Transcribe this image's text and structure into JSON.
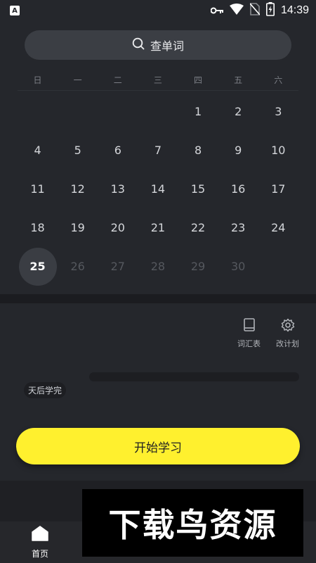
{
  "status_bar": {
    "app_badge": "A",
    "time": "14:39",
    "icons": [
      "key-icon",
      "wifi-icon",
      "no-sim-icon",
      "battery-charging-icon"
    ]
  },
  "search": {
    "label": "查单词",
    "icon": "search-icon"
  },
  "calendar": {
    "weekdays": [
      "日",
      "一",
      "二",
      "三",
      "四",
      "五",
      "六"
    ],
    "days": [
      "1",
      "2",
      "3",
      "4",
      "5",
      "6",
      "7",
      "8",
      "9",
      "10",
      "11",
      "12",
      "13",
      "14",
      "15",
      "16",
      "17",
      "18",
      "19",
      "20",
      "21",
      "22",
      "23",
      "24",
      "25",
      "26",
      "27",
      "28",
      "29",
      "30"
    ],
    "leading_blanks": 4,
    "today": "25"
  },
  "tools": {
    "vocab_label": "词汇表",
    "vocab_icon": "book-icon",
    "plan_label": "改计划",
    "plan_icon": "gear-icon"
  },
  "plan": {
    "days_left_label": "天后学完",
    "progress": 0
  },
  "actions": {
    "start_label": "开始学习"
  },
  "tabbar": {
    "home_label": "首页",
    "home_icon": "home-icon"
  },
  "watermark": {
    "text": "下载鸟资源"
  },
  "colors": {
    "background": "#25272c",
    "accent": "#fff02e",
    "search_bg": "#3b3e44",
    "today_bg": "#3a3d43"
  }
}
